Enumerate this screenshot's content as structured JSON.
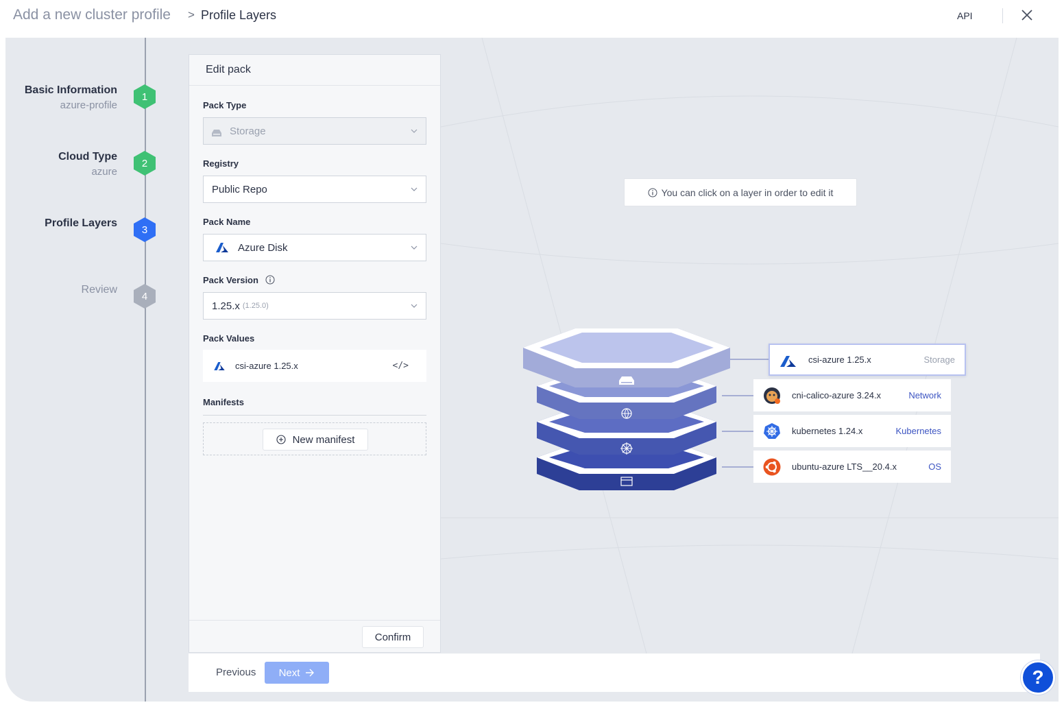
{
  "header": {
    "breadcrumb_root": "Add a new cluster profile",
    "breadcrumb_separator": ">",
    "breadcrumb_current": "Profile Layers",
    "api_label": "API",
    "close_icon": "close-icon"
  },
  "steps": [
    {
      "number": "1",
      "title": "Basic Information",
      "subtitle": "azure-profile",
      "status": "done"
    },
    {
      "number": "2",
      "title": "Cloud Type",
      "subtitle": "azure",
      "status": "done"
    },
    {
      "number": "3",
      "title": "Profile Layers",
      "subtitle": "",
      "status": "active"
    },
    {
      "number": "4",
      "title": "Review",
      "subtitle": "",
      "status": "todo"
    }
  ],
  "edit_pack": {
    "title": "Edit pack",
    "pack_type_label": "Pack Type",
    "pack_type_value": "Storage",
    "registry_label": "Registry",
    "registry_value": "Public Repo",
    "pack_name_label": "Pack Name",
    "pack_name_value": "Azure Disk",
    "pack_version_label": "Pack Version",
    "pack_version_value": "1.25.x",
    "pack_version_detail": "(1.25.0)",
    "pack_values_label": "Pack Values",
    "pack_values_item": "csi-azure 1.25.x",
    "manifests_label": "Manifests",
    "new_manifest_label": "New manifest",
    "confirm_label": "Confirm"
  },
  "canvas": {
    "tip_text": "You can click on a layer in order to edit it",
    "layers": [
      {
        "name": "csi-azure 1.25.x",
        "type": "Storage",
        "type_color": "#9aa1af",
        "logo": "azure-logo-icon",
        "selected": true
      },
      {
        "name": "cni-calico-azure 3.24.x",
        "type": "Network",
        "type_color": "#3d55c2",
        "logo": "calico-logo-icon",
        "selected": false
      },
      {
        "name": "kubernetes 1.24.x",
        "type": "Kubernetes",
        "type_color": "#3d55c2",
        "logo": "kubernetes-logo-icon",
        "selected": false
      },
      {
        "name": "ubuntu-azure LTS__20.4.x",
        "type": "OS",
        "type_color": "#3d55c2",
        "logo": "ubuntu-logo-icon",
        "selected": false
      }
    ]
  },
  "footer": {
    "previous_label": "Previous",
    "next_label": "Next"
  },
  "help_label": "?",
  "colors": {
    "accent": "#2f6ff5",
    "step_done": "#3fc174",
    "next_disabled": "#8faef7",
    "layer_dark": "#2d3f96"
  }
}
